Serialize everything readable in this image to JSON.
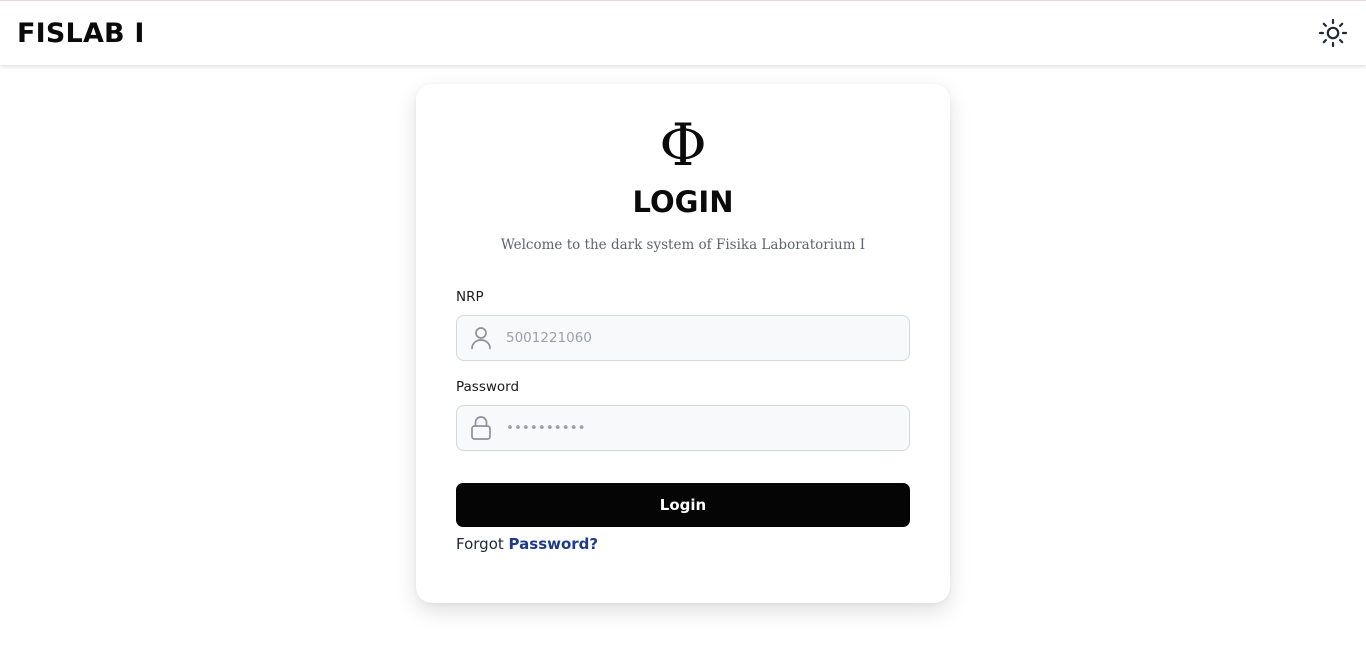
{
  "header": {
    "brand": "FISLAB I",
    "theme_toggle_icon": "sun-icon"
  },
  "login_card": {
    "logo_symbol": "Φ",
    "title": "LOGIN",
    "subtitle": "Welcome to the dark system of Fisika Laboratorium I",
    "nrp": {
      "label": "NRP",
      "placeholder": "5001221060",
      "value": "",
      "icon": "user-icon"
    },
    "password": {
      "label": "Password",
      "placeholder": "••••••••••",
      "value": "",
      "icon": "lock-icon"
    },
    "submit_label": "Login",
    "forgot_prefix": "Forgot",
    "forgot_link": "Password?"
  },
  "colors": {
    "button_bg": "#050505",
    "link": "#1e3a8a",
    "subtitle": "#5b6472",
    "field_bg": "#f8f9fb"
  }
}
